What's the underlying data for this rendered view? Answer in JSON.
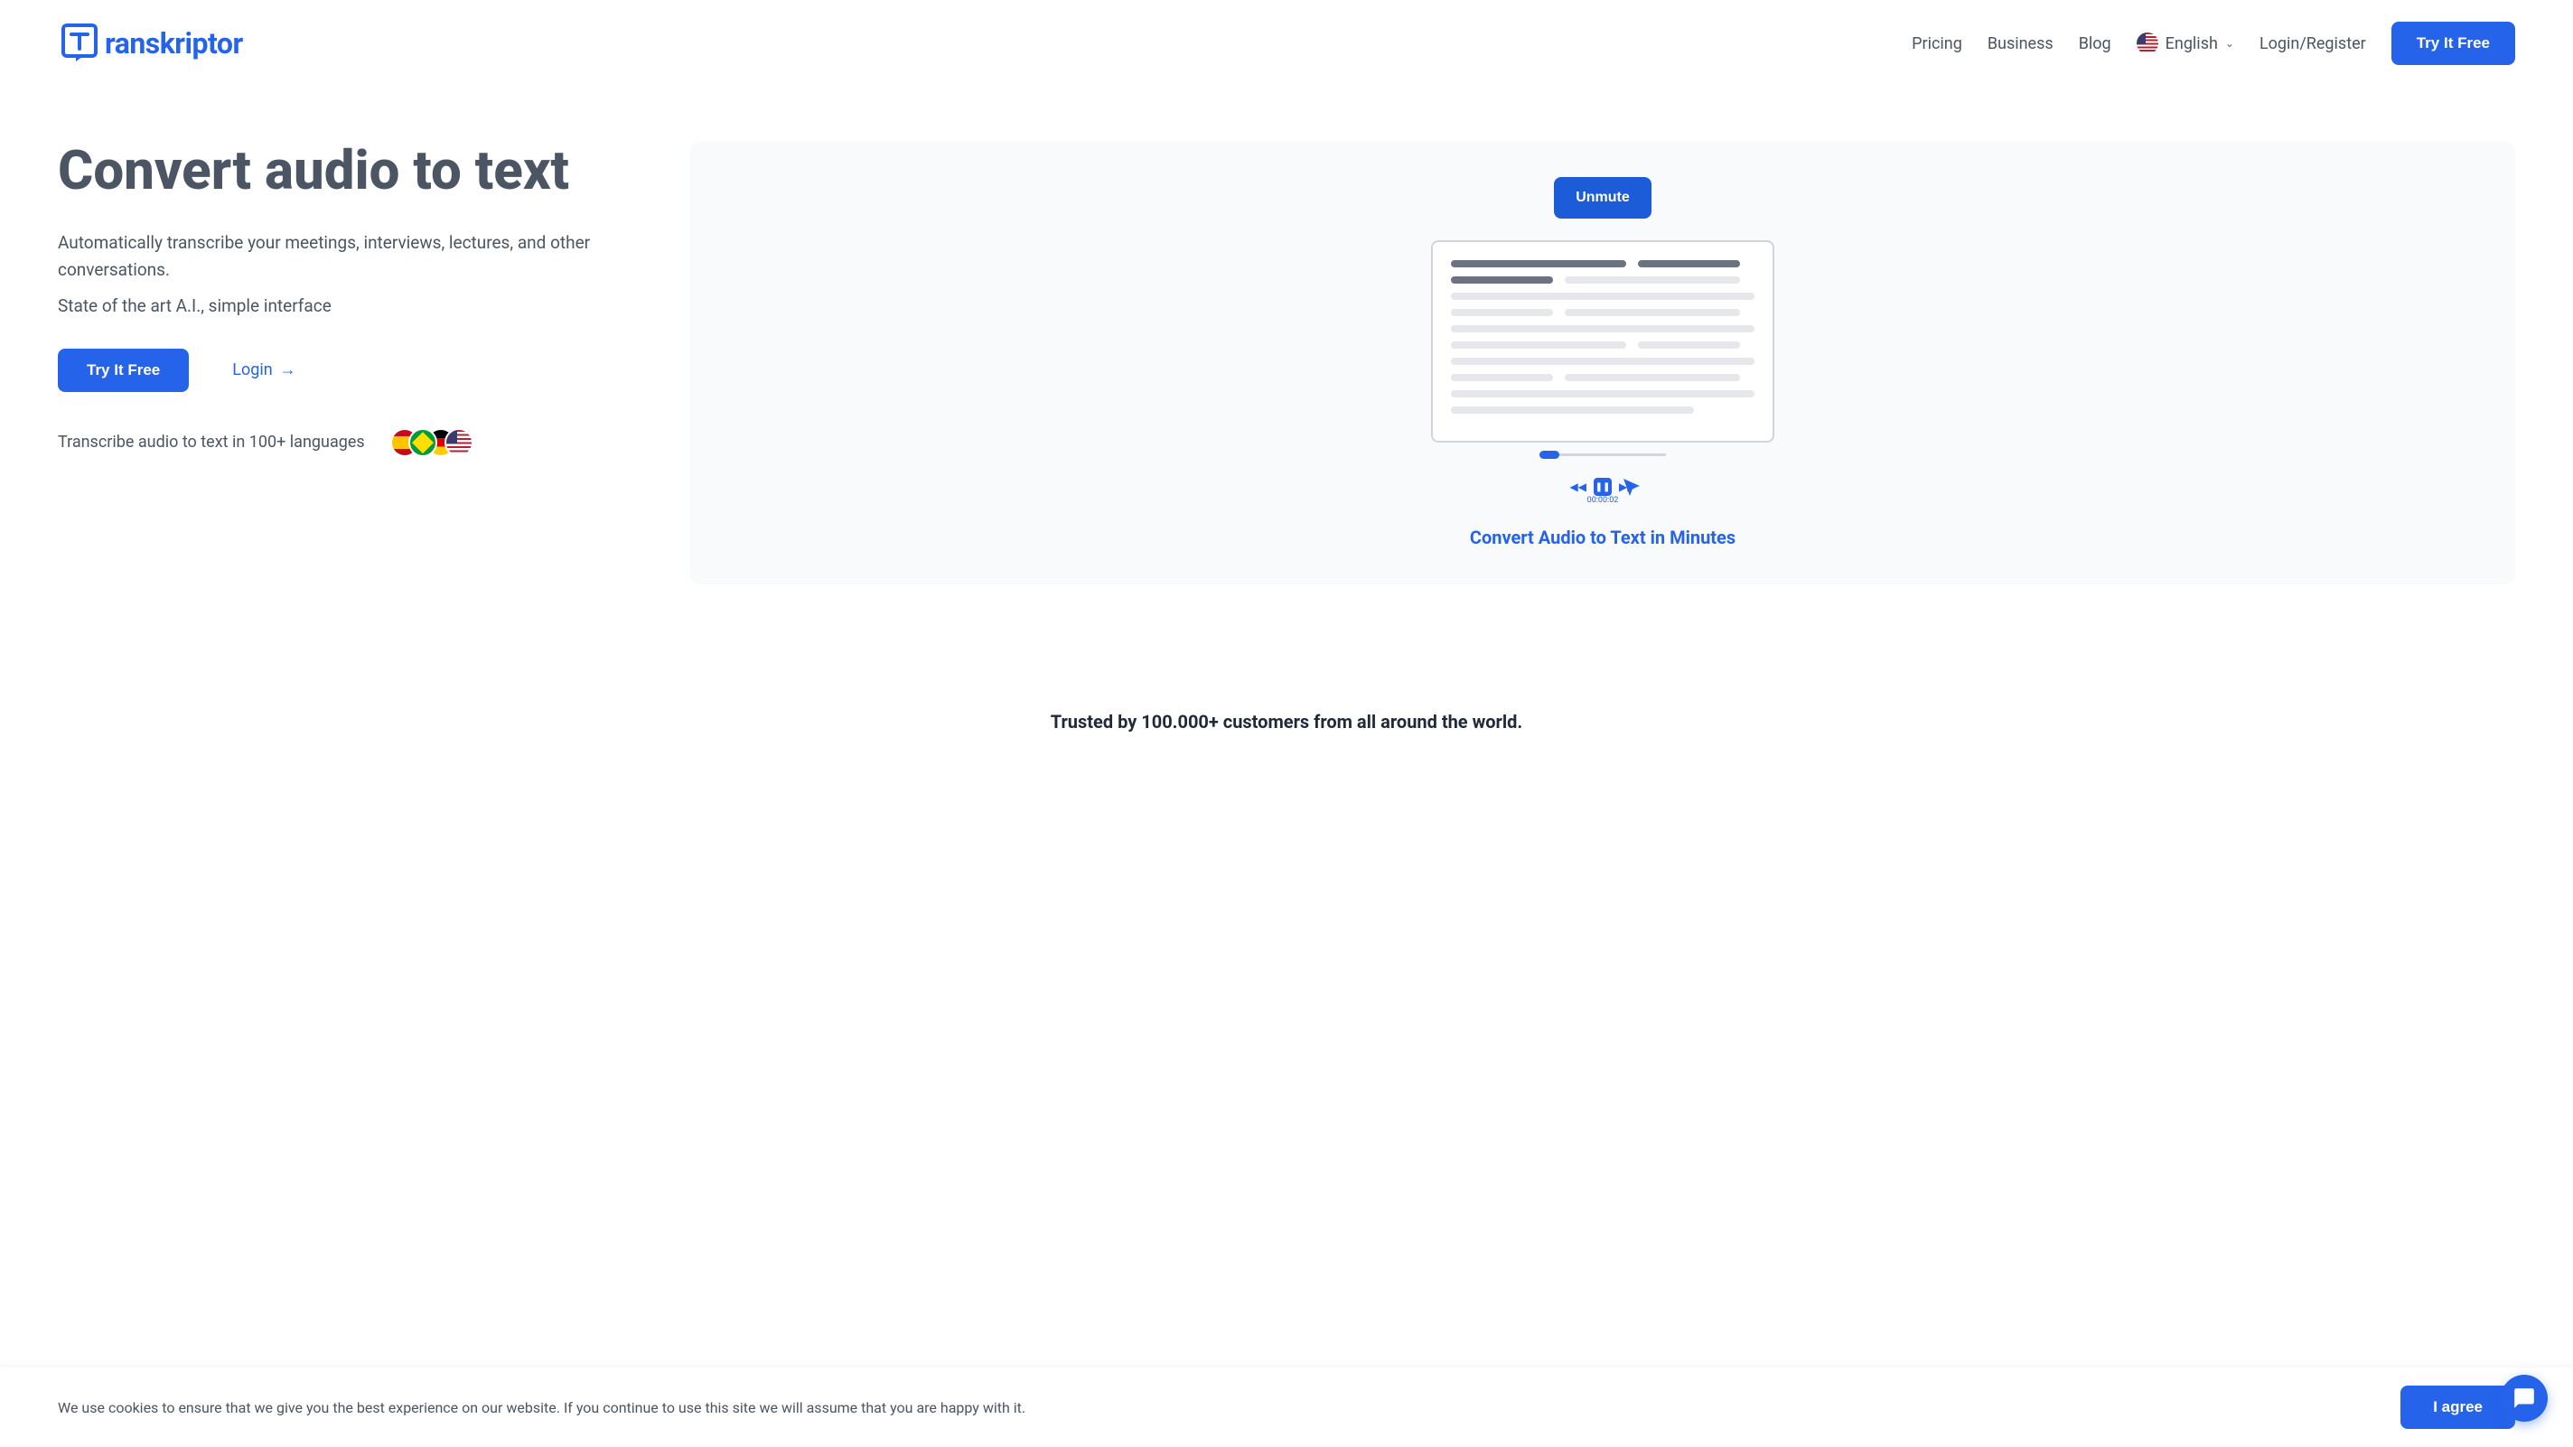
{
  "header": {
    "logo_text": "ranskriptor",
    "nav": {
      "pricing": "Pricing",
      "business": "Business",
      "blog": "Blog",
      "language": "English",
      "login_register": "Login/Register"
    },
    "cta": "Try It Free"
  },
  "hero": {
    "title": "Convert audio to text",
    "description": "Automatically transcribe your meetings, interviews, lectures, and other conversations.",
    "sub_description": "State of the art A.I., simple interface",
    "cta": "Try It Free",
    "login": "Login",
    "languages_text": "Transcribe audio to text in 100+ languages"
  },
  "video": {
    "unmute": "Unmute",
    "caption": "Convert Audio to Text in Minutes",
    "time": "00:00:02"
  },
  "trusted": {
    "text": "Trusted by 100.000+ customers from all around the world."
  },
  "cookie": {
    "text": "We use cookies to ensure that we give you the best experience on our website. If you continue to use this site we will assume that you are happy with it.",
    "agree": "I agree"
  }
}
